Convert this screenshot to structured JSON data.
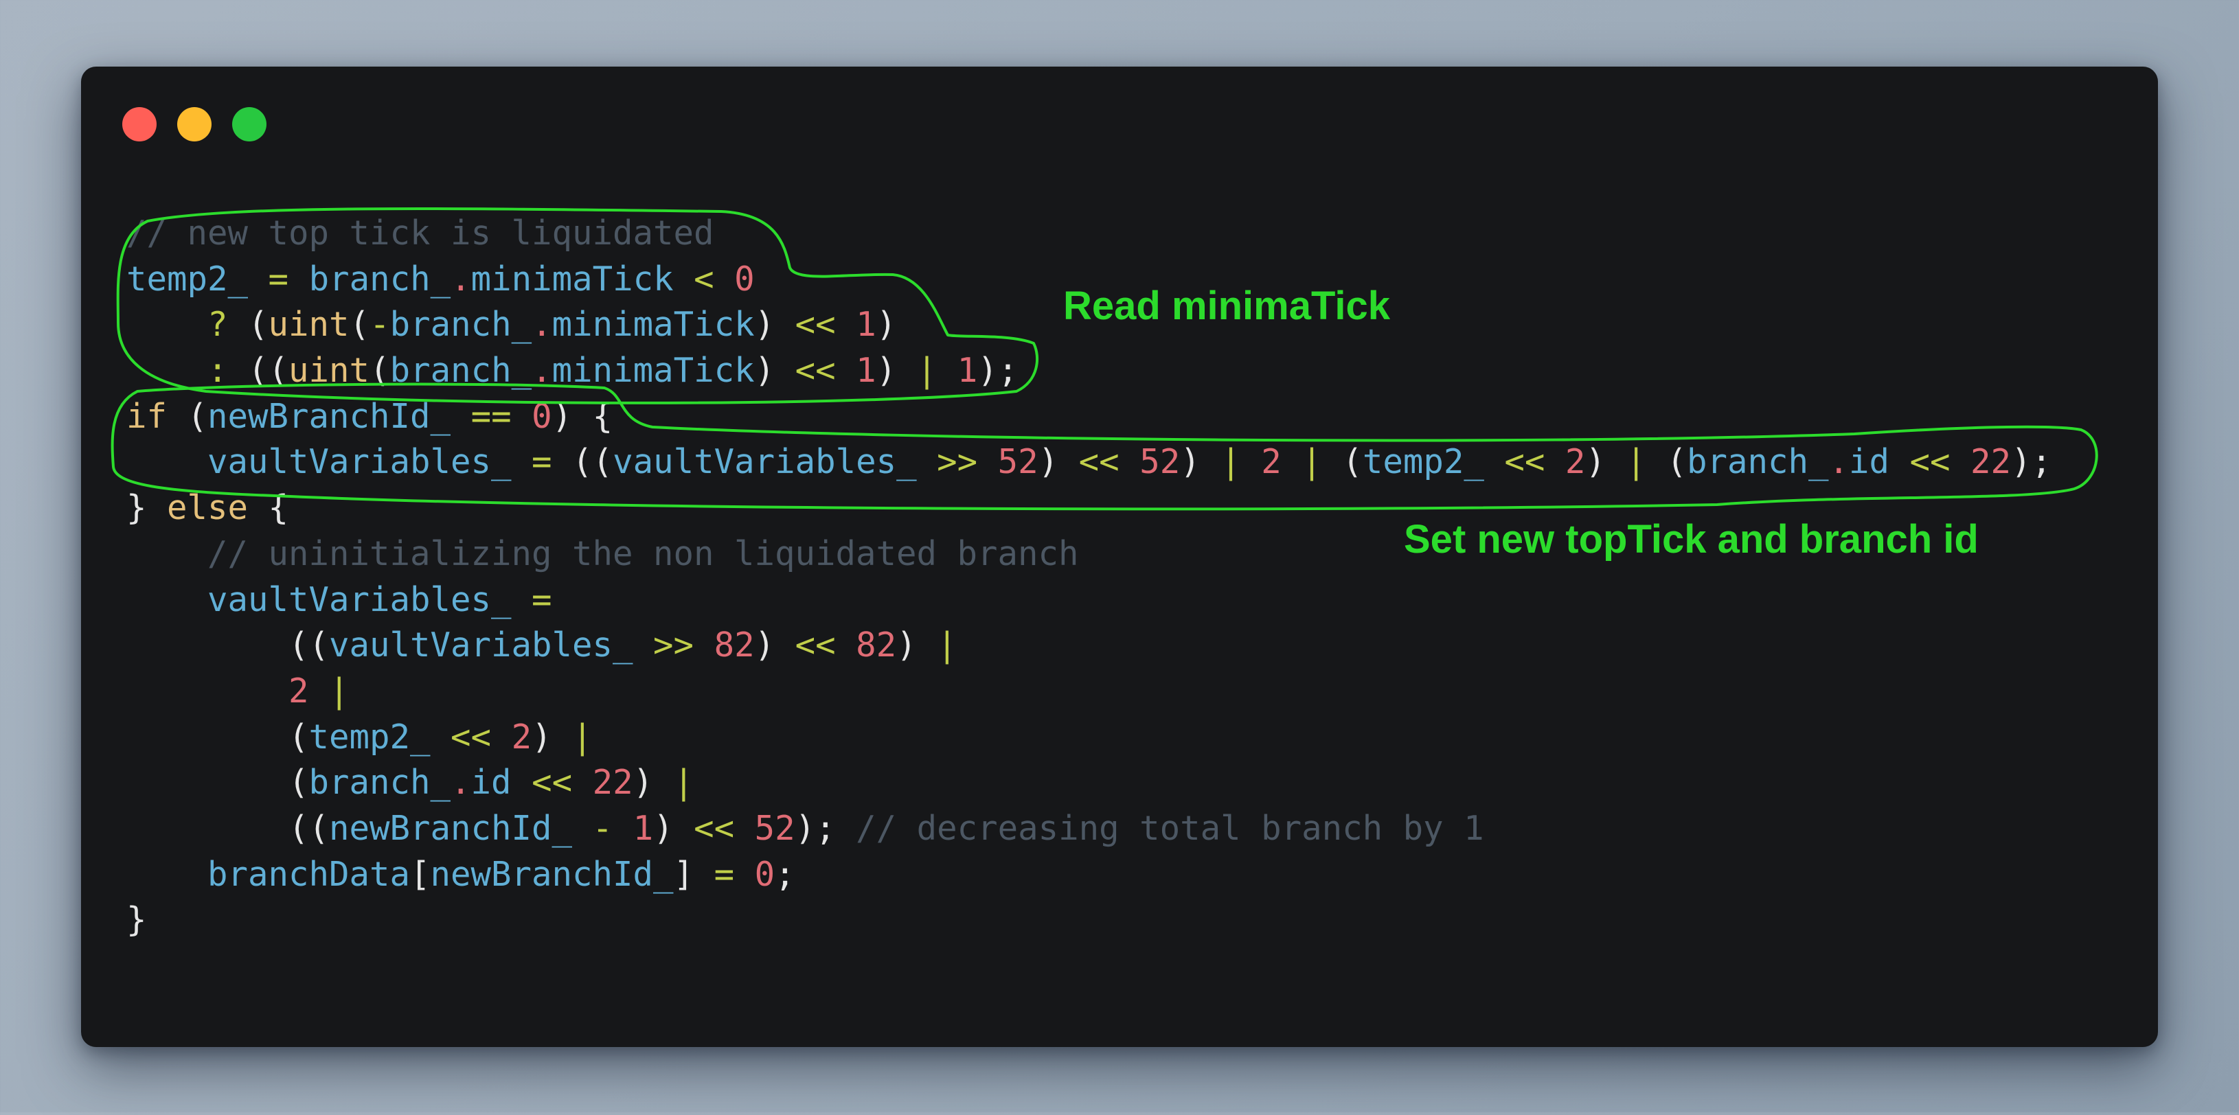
{
  "window": {
    "traffic_lights": {
      "close_color": "#ff5f57",
      "minimize_color": "#febc2e",
      "zoom_color": "#28c840"
    }
  },
  "code": {
    "colors": {
      "comment": "#4c5763",
      "identifier": "#61afd6",
      "operator": "#c1cf4a",
      "number": "#e06c75",
      "function": "#e5c07b",
      "keyword": "#e5c07b",
      "punct": "#e6e6e6"
    },
    "lines": [
      [
        [
          "comment",
          "// new top tick is liquidated"
        ]
      ],
      [
        [
          "ident",
          "temp2_"
        ],
        [
          "punct",
          " "
        ],
        [
          "op",
          "="
        ],
        [
          "punct",
          " "
        ],
        [
          "ident",
          "branch_"
        ],
        [
          "num",
          "."
        ],
        [
          "ident",
          "minimaTick"
        ],
        [
          "punct",
          " "
        ],
        [
          "op",
          "<"
        ],
        [
          "punct",
          " "
        ],
        [
          "num",
          "0"
        ]
      ],
      [
        [
          "punct",
          "    "
        ],
        [
          "op",
          "?"
        ],
        [
          "punct",
          " ("
        ],
        [
          "fn",
          "uint"
        ],
        [
          "punct",
          "("
        ],
        [
          "op",
          "-"
        ],
        [
          "ident",
          "branch_"
        ],
        [
          "num",
          "."
        ],
        [
          "ident",
          "minimaTick"
        ],
        [
          "punct",
          ") "
        ],
        [
          "op",
          "<<"
        ],
        [
          "punct",
          " "
        ],
        [
          "num",
          "1"
        ],
        [
          "punct",
          ")"
        ]
      ],
      [
        [
          "punct",
          "    "
        ],
        [
          "op",
          ":"
        ],
        [
          "punct",
          " (("
        ],
        [
          "fn",
          "uint"
        ],
        [
          "punct",
          "("
        ],
        [
          "ident",
          "branch_"
        ],
        [
          "num",
          "."
        ],
        [
          "ident",
          "minimaTick"
        ],
        [
          "punct",
          ") "
        ],
        [
          "op",
          "<<"
        ],
        [
          "punct",
          " "
        ],
        [
          "num",
          "1"
        ],
        [
          "punct",
          ") "
        ],
        [
          "op",
          "|"
        ],
        [
          "punct",
          " "
        ],
        [
          "num",
          "1"
        ],
        [
          "punct",
          ");"
        ]
      ],
      [
        [
          "kw",
          "if"
        ],
        [
          "punct",
          " ("
        ],
        [
          "ident",
          "newBranchId_"
        ],
        [
          "punct",
          " "
        ],
        [
          "op",
          "=="
        ],
        [
          "punct",
          " "
        ],
        [
          "num",
          "0"
        ],
        [
          "punct",
          ") {"
        ]
      ],
      [
        [
          "punct",
          "    "
        ],
        [
          "ident",
          "vaultVariables_"
        ],
        [
          "punct",
          " "
        ],
        [
          "op",
          "="
        ],
        [
          "punct",
          " (("
        ],
        [
          "ident",
          "vaultVariables_"
        ],
        [
          "punct",
          " "
        ],
        [
          "op",
          ">>"
        ],
        [
          "punct",
          " "
        ],
        [
          "num",
          "52"
        ],
        [
          "punct",
          ") "
        ],
        [
          "op",
          "<<"
        ],
        [
          "punct",
          " "
        ],
        [
          "num",
          "52"
        ],
        [
          "punct",
          ") "
        ],
        [
          "op",
          "|"
        ],
        [
          "punct",
          " "
        ],
        [
          "num",
          "2"
        ],
        [
          "punct",
          " "
        ],
        [
          "op",
          "|"
        ],
        [
          "punct",
          " ("
        ],
        [
          "ident",
          "temp2_"
        ],
        [
          "punct",
          " "
        ],
        [
          "op",
          "<<"
        ],
        [
          "punct",
          " "
        ],
        [
          "num",
          "2"
        ],
        [
          "punct",
          ") "
        ],
        [
          "op",
          "|"
        ],
        [
          "punct",
          " ("
        ],
        [
          "ident",
          "branch_"
        ],
        [
          "num",
          "."
        ],
        [
          "ident",
          "id"
        ],
        [
          "punct",
          " "
        ],
        [
          "op",
          "<<"
        ],
        [
          "punct",
          " "
        ],
        [
          "num",
          "22"
        ],
        [
          "punct",
          ");"
        ]
      ],
      [
        [
          "punct",
          "} "
        ],
        [
          "kw",
          "else"
        ],
        [
          "punct",
          " {"
        ]
      ],
      [
        [
          "punct",
          "    "
        ],
        [
          "comment",
          "// uninitializing the non liquidated branch"
        ]
      ],
      [
        [
          "punct",
          "    "
        ],
        [
          "ident",
          "vaultVariables_"
        ],
        [
          "punct",
          " "
        ],
        [
          "op",
          "="
        ]
      ],
      [
        [
          "punct",
          "        (("
        ],
        [
          "ident",
          "vaultVariables_"
        ],
        [
          "punct",
          " "
        ],
        [
          "op",
          ">>"
        ],
        [
          "punct",
          " "
        ],
        [
          "num",
          "82"
        ],
        [
          "punct",
          ") "
        ],
        [
          "op",
          "<<"
        ],
        [
          "punct",
          " "
        ],
        [
          "num",
          "82"
        ],
        [
          "punct",
          ") "
        ],
        [
          "op",
          "|"
        ]
      ],
      [
        [
          "punct",
          "        "
        ],
        [
          "num",
          "2"
        ],
        [
          "punct",
          " "
        ],
        [
          "op",
          "|"
        ]
      ],
      [
        [
          "punct",
          "        ("
        ],
        [
          "ident",
          "temp2_"
        ],
        [
          "punct",
          " "
        ],
        [
          "op",
          "<<"
        ],
        [
          "punct",
          " "
        ],
        [
          "num",
          "2"
        ],
        [
          "punct",
          ") "
        ],
        [
          "op",
          "|"
        ]
      ],
      [
        [
          "punct",
          "        ("
        ],
        [
          "ident",
          "branch_"
        ],
        [
          "num",
          "."
        ],
        [
          "ident",
          "id"
        ],
        [
          "punct",
          " "
        ],
        [
          "op",
          "<<"
        ],
        [
          "punct",
          " "
        ],
        [
          "num",
          "22"
        ],
        [
          "punct",
          ") "
        ],
        [
          "op",
          "|"
        ]
      ],
      [
        [
          "punct",
          "        (("
        ],
        [
          "ident",
          "newBranchId_"
        ],
        [
          "punct",
          " "
        ],
        [
          "op",
          "-"
        ],
        [
          "punct",
          " "
        ],
        [
          "num",
          "1"
        ],
        [
          "punct",
          ") "
        ],
        [
          "op",
          "<<"
        ],
        [
          "punct",
          " "
        ],
        [
          "num",
          "52"
        ],
        [
          "punct",
          "); "
        ],
        [
          "comment",
          "// decreasing total branch by 1"
        ]
      ],
      [
        [
          "punct",
          "    "
        ],
        [
          "ident",
          "branchData"
        ],
        [
          "punct",
          "["
        ],
        [
          "ident",
          "newBranchId_"
        ],
        [
          "punct",
          "] "
        ],
        [
          "op",
          "="
        ],
        [
          "punct",
          " "
        ],
        [
          "num",
          "0"
        ],
        [
          "punct",
          ";"
        ]
      ],
      [
        [
          "punct",
          "}"
        ]
      ]
    ]
  },
  "annotations": {
    "stroke_color": "#2cdc2c",
    "read_note": "Read minimaTick",
    "set_note": "Set new topTick and branch id"
  }
}
